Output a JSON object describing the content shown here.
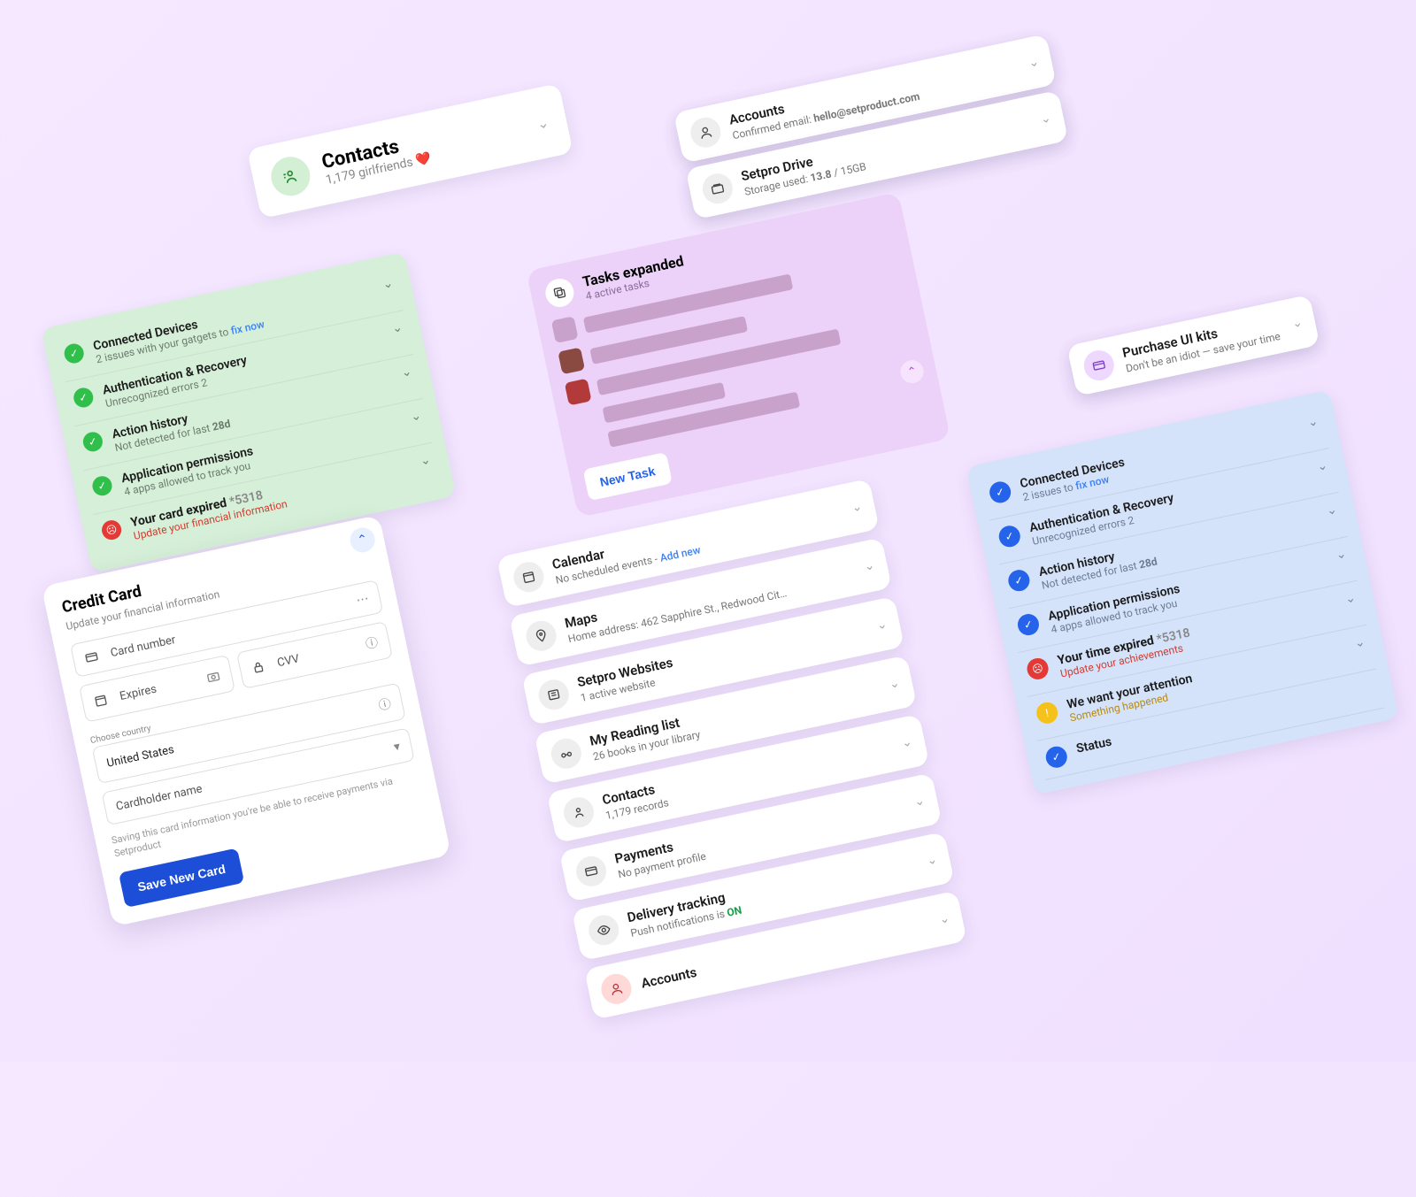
{
  "contacts_card": {
    "title": "Contacts",
    "sub": "1,179 girlfriends ❤️"
  },
  "accounts_row": {
    "title": "Accounts",
    "sub_prefix": "Confirmed email: ",
    "email": "hello@setproduct.com"
  },
  "drive_row": {
    "title": "Setpro Drive",
    "sub_prefix": "Storage used: ",
    "used": "13.8",
    "sep": " / ",
    "total": "15GB"
  },
  "green": {
    "items": [
      {
        "title": "Connected Devices",
        "sub_pre": "2 issues with your gatgets to ",
        "link": "fix now"
      },
      {
        "title": "Authentication & Recovery",
        "sub": "Unrecognized errors 2"
      },
      {
        "title": "Action history",
        "sub_pre": "Not detected for last ",
        "bold": "28d"
      },
      {
        "title": "Application permissions",
        "sub": "4 apps allowed to track you"
      }
    ],
    "bad": {
      "title_pre": "Your card expired ",
      "code": "*5318",
      "sub": "Update your financial information"
    }
  },
  "cc": {
    "heading": "Credit Card",
    "hint": "Update your financial information",
    "card_number": "Card number",
    "expires": "Expires",
    "cvv": "CVV",
    "country_label": "Choose country",
    "country": "United States",
    "holder": "Cardholder name",
    "fine": "Saving this card information you're be able to receive payments via Setproduct",
    "save": "Save New Card"
  },
  "tasks": {
    "title": "Tasks expanded",
    "sub": "4 active tasks",
    "new_task": "New Task"
  },
  "mid": {
    "calendar": {
      "title": "Calendar",
      "sub_pre": "No scheduled events - ",
      "link": "Add new"
    },
    "maps": {
      "title": "Maps",
      "sub": "Home address: 462 Sapphire St., Redwood Cit…"
    },
    "websites": {
      "title": "Setpro Websites",
      "sub": "1 active website"
    },
    "reading": {
      "title": "My Reading list",
      "sub": "26 books in your library"
    },
    "contacts": {
      "title": "Contacts",
      "sub": "1,179 records"
    },
    "payments": {
      "title": "Payments",
      "sub": "No payment profile"
    },
    "delivery": {
      "title": "Delivery tracking",
      "sub_pre": "Push notifications is ",
      "on": "ON"
    },
    "accounts": {
      "title": "Accounts"
    }
  },
  "promo": {
    "title": "Purchase UI kits",
    "sub": "Don't be an idiot — save your time"
  },
  "blue": {
    "items": [
      {
        "title": "Connected Devices",
        "sub_pre": "2 issues to ",
        "link": "fix now"
      },
      {
        "title": "Authentication & Recovery",
        "sub": "Unrecognized errors 2"
      },
      {
        "title": "Action history",
        "sub_pre": "Not detected for last ",
        "bold": "28d"
      },
      {
        "title": "Application permissions",
        "sub": "4 apps allowed to track you"
      }
    ],
    "bad": {
      "title_pre": "Your time expired ",
      "code": "*5318",
      "sub": "Update your achievements"
    },
    "warn": {
      "title": "We want your attention",
      "sub": "Something happened"
    },
    "extra": {
      "title": "Status"
    }
  }
}
